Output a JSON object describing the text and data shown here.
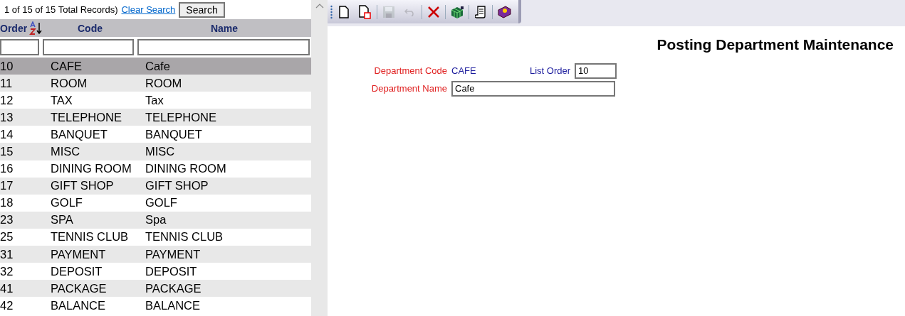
{
  "list_panel": {
    "record_info": "1 of 15 of 15 Total Records)",
    "clear_link": "Clear Search",
    "search_button": "Search",
    "columns": [
      {
        "label": "Order",
        "sorted": true
      },
      {
        "label": "Code",
        "sorted": false
      },
      {
        "label": "Name",
        "sorted": false
      }
    ],
    "rows": [
      {
        "cells": [
          "10",
          "CAFE",
          "Cafe"
        ],
        "selected": true
      },
      {
        "cells": [
          "11",
          "ROOM",
          "ROOM"
        ],
        "selected": false
      },
      {
        "cells": [
          "12",
          "TAX",
          "Tax"
        ],
        "selected": false
      },
      {
        "cells": [
          "13",
          "TELEPHONE",
          "TELEPHONE"
        ],
        "selected": false
      },
      {
        "cells": [
          "14",
          "BANQUET",
          "BANQUET"
        ],
        "selected": false
      },
      {
        "cells": [
          "15",
          "MISC",
          "MISC"
        ],
        "selected": false
      },
      {
        "cells": [
          "16",
          "DINING ROOM",
          "DINING ROOM"
        ],
        "selected": false
      },
      {
        "cells": [
          "17",
          "GIFT SHOP",
          "GIFT SHOP"
        ],
        "selected": false
      },
      {
        "cells": [
          "18",
          "GOLF",
          "GOLF"
        ],
        "selected": false
      },
      {
        "cells": [
          "23",
          "SPA",
          "Spa"
        ],
        "selected": false
      },
      {
        "cells": [
          "25",
          "TENNIS CLUB",
          "TENNIS CLUB"
        ],
        "selected": false
      },
      {
        "cells": [
          "31",
          "PAYMENT",
          "PAYMENT"
        ],
        "selected": false
      },
      {
        "cells": [
          "32",
          "DEPOSIT",
          "DEPOSIT"
        ],
        "selected": false
      },
      {
        "cells": [
          "41",
          "PACKAGE",
          "PACKAGE"
        ],
        "selected": false
      },
      {
        "cells": [
          "42",
          "BALANCE",
          "BALANCE"
        ],
        "selected": false
      }
    ]
  },
  "toolbar": {
    "buttons": [
      {
        "kind": "new",
        "disabled": false
      },
      {
        "kind": "copy",
        "disabled": false
      },
      {
        "kind": "save",
        "disabled": true
      },
      {
        "kind": "undo",
        "disabled": true
      },
      {
        "kind": "delete",
        "disabled": false
      },
      {
        "kind": "grid",
        "disabled": false
      },
      {
        "kind": "scroll",
        "disabled": false
      },
      {
        "kind": "help",
        "disabled": false
      }
    ]
  },
  "form": {
    "title": "Posting Department Maintenance",
    "department_code": {
      "label": "Department Code",
      "value": "CAFE"
    },
    "list_order": {
      "label": "List Order",
      "value": "10"
    },
    "department_name": {
      "label": "Department Name",
      "value": "Cafe"
    }
  }
}
